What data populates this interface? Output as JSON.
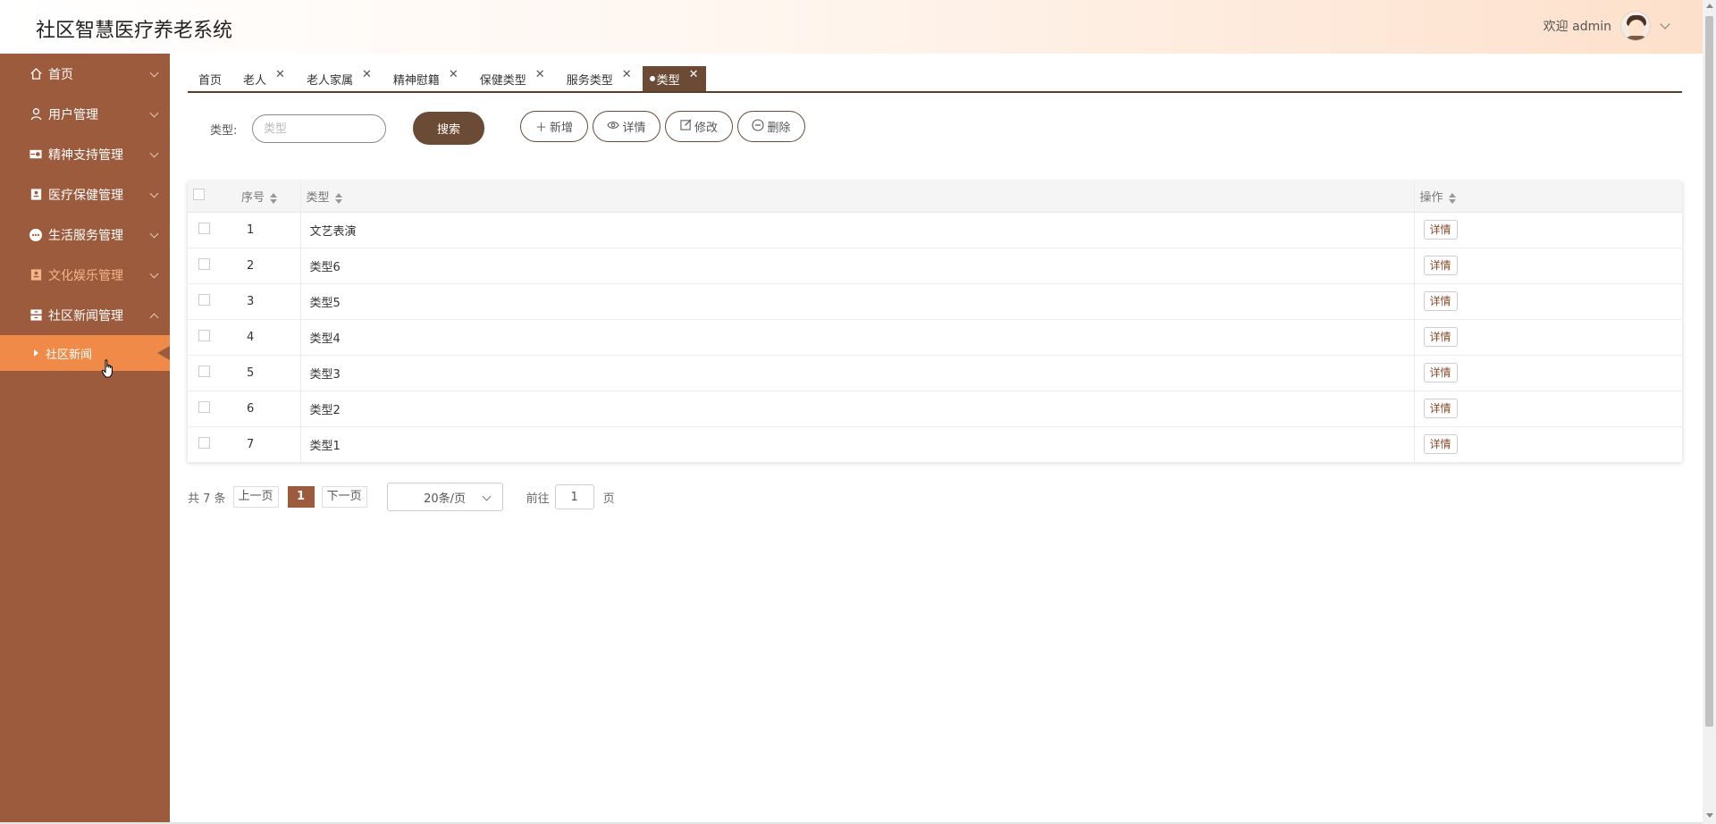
{
  "header": {
    "title": "社区智慧医疗养老系统",
    "welcome": "欢迎 admin"
  },
  "sidebar": {
    "items": [
      {
        "label": "首页",
        "icon": "home-icon"
      },
      {
        "label": "用户管理",
        "icon": "user-icon"
      },
      {
        "label": "精神支持管理",
        "icon": "toggle-icon"
      },
      {
        "label": "医疗保健管理",
        "icon": "medical-icon"
      },
      {
        "label": "生活服务管理",
        "icon": "chat-icon"
      },
      {
        "label": "文化娱乐管理",
        "icon": "culture-icon"
      },
      {
        "label": "社区新闻管理",
        "icon": "archive-icon"
      }
    ],
    "sub_items": [
      {
        "label": "社区新闻"
      }
    ]
  },
  "tabs": [
    {
      "label": "首页"
    },
    {
      "label": "老人"
    },
    {
      "label": "老人家属"
    },
    {
      "label": "精神慰籍"
    },
    {
      "label": "保健类型"
    },
    {
      "label": "服务类型"
    },
    {
      "label": "类型"
    }
  ],
  "search": {
    "label": "类型:",
    "placeholder": "类型",
    "button": "搜索"
  },
  "actions": {
    "add": "新增",
    "detail": "详情",
    "edit": "修改",
    "delete": "删除"
  },
  "table": {
    "headers": {
      "index": "序号",
      "type": "类型",
      "op": "操作"
    },
    "detail_label": "详情",
    "rows": [
      {
        "index": "1",
        "type": "文艺表演"
      },
      {
        "index": "2",
        "type": "类型6"
      },
      {
        "index": "3",
        "type": "类型5"
      },
      {
        "index": "4",
        "type": "类型4"
      },
      {
        "index": "5",
        "type": "类型3"
      },
      {
        "index": "6",
        "type": "类型2"
      },
      {
        "index": "7",
        "type": "类型1"
      }
    ]
  },
  "pagination": {
    "total": "共 7 条",
    "prev": "上一页",
    "current": "1",
    "next": "下一页",
    "page_size": "20条/页",
    "goto": "前往",
    "goto_value": "1",
    "page_unit": "页"
  },
  "colors": {
    "sidebar": "#9b5b3c",
    "active_sub": "#f08a48",
    "primary": "#6b4a36"
  }
}
